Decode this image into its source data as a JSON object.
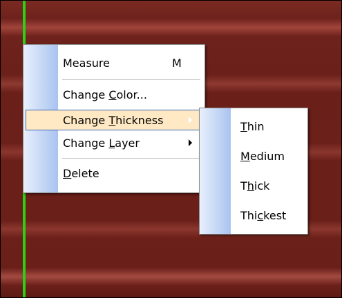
{
  "context_menu": {
    "items": [
      {
        "label": "Measure",
        "shortcut": "M"
      },
      {
        "label_pre": "Change ",
        "label_key": "C",
        "label_post": "olor..."
      },
      {
        "label_pre": "Change ",
        "label_key": "T",
        "label_post": "hickness",
        "highlighted": true,
        "submenu": true
      },
      {
        "label_pre": "Change ",
        "label_key": "L",
        "label_post": "ayer",
        "submenu": true
      },
      {
        "label_key": "D",
        "label_post": "elete"
      }
    ]
  },
  "thickness_submenu": {
    "items": [
      {
        "label_key": "T",
        "label_post": "hin"
      },
      {
        "label_key": "M",
        "label_post": "edium"
      },
      {
        "label_pre": "T",
        "label_key": "h",
        "label_post": "ick"
      },
      {
        "label_pre": "Thi",
        "label_key": "c",
        "label_post": "kest"
      }
    ]
  },
  "colors": {
    "background_wood": "#6a1f19",
    "guide_line": "#27d312",
    "highlight_fill": "#ffe9c4",
    "highlight_border": "#3b64b8",
    "menu_strip": "#a9c3f0"
  }
}
